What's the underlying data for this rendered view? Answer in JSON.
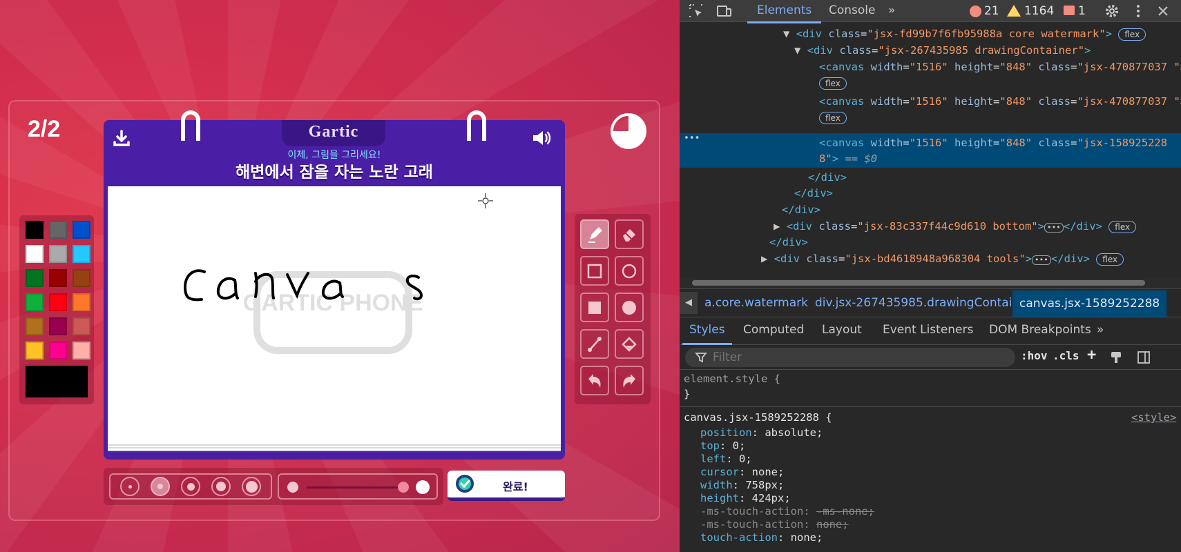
{
  "game": {
    "round_counter": "2/2",
    "logo": "Gartic",
    "hint": "이제, 그림을 그리세요!",
    "prompt": "해변에서 잠을 자는 노란 고래",
    "done_label": "완료!",
    "watermark": "GARTIC PHONE",
    "timer_fraction_remaining": 0.75,
    "palette": [
      "#000000",
      "#666666",
      "#0050cd",
      "#ffffff",
      "#aaaaaa",
      "#26c9ff",
      "#017420",
      "#990000",
      "#964112",
      "#11b03c",
      "#ff0013",
      "#ff7829",
      "#b0701c",
      "#99004e",
      "#cb5a57",
      "#ffc126",
      "#ff008f",
      "#feafa8"
    ],
    "current_color": "#000000",
    "brush_sizes": [
      1,
      2,
      3,
      4,
      5
    ],
    "selected_brush_size": 2,
    "opacity_fraction": 0.9,
    "tools": [
      "pen-tool",
      "eraser-tool",
      "rectangle-outline-tool",
      "ellipse-outline-tool",
      "rectangle-fill-tool",
      "ellipse-fill-tool",
      "line-tool",
      "fill-bucket-tool",
      "undo-tool",
      "redo-tool"
    ],
    "active_tool": "pen-tool"
  },
  "devtools": {
    "tabs": [
      "Elements",
      "Console"
    ],
    "active_tab": "Elements",
    "errors": "21",
    "warnings": "1164",
    "messages": "1",
    "tree": {
      "l1_class": "jsx-fd99b7f6fb95988a core watermark",
      "l2_class": "jsx-267435985 drawingContainer",
      "canvas_width": "1516",
      "canvas_height": "848",
      "canvas1_class": "jsx-470877037 ",
      "canvas2_class": "jsx-470877037 ",
      "canvas3_class_a": "jsx-158925228",
      "canvas3_class_b": "8",
      "selected_marker": "== $0",
      "bottom_class": "jsx-83c337f44c9d610 bottom",
      "tools_class": "jsx-bd4618948a968304 tools",
      "flex_badge": "flex"
    },
    "breadcrumbs": [
      "a.core.watermark",
      "div.jsx-267435985.drawingContainer",
      "canvas.jsx-1589252288"
    ],
    "subtabs": [
      "Styles",
      "Computed",
      "Layout",
      "Event Listeners",
      "DOM Breakpoints"
    ],
    "active_subtab": "Styles",
    "filter_placeholder": "Filter",
    "hov_label": ":hov",
    "cls_label": ".cls",
    "element_style": "element.style {",
    "close_brace": "}",
    "rule_selector": "canvas.jsx-1589252288 {",
    "rule_source": "<style>",
    "props": [
      {
        "name": "position",
        "value": "absolute;"
      },
      {
        "name": "top",
        "value": "0;"
      },
      {
        "name": "left",
        "value": "0;"
      },
      {
        "name": "cursor",
        "value": "none;"
      },
      {
        "name": "width",
        "value": "758px;"
      },
      {
        "name": "height",
        "value": "424px;"
      },
      {
        "name": "-ms-touch-action",
        "value": "-ms-none;"
      },
      {
        "name": "-ms-touch-action",
        "value": "none;"
      },
      {
        "name": "touch-action",
        "value": "none;"
      }
    ]
  }
}
